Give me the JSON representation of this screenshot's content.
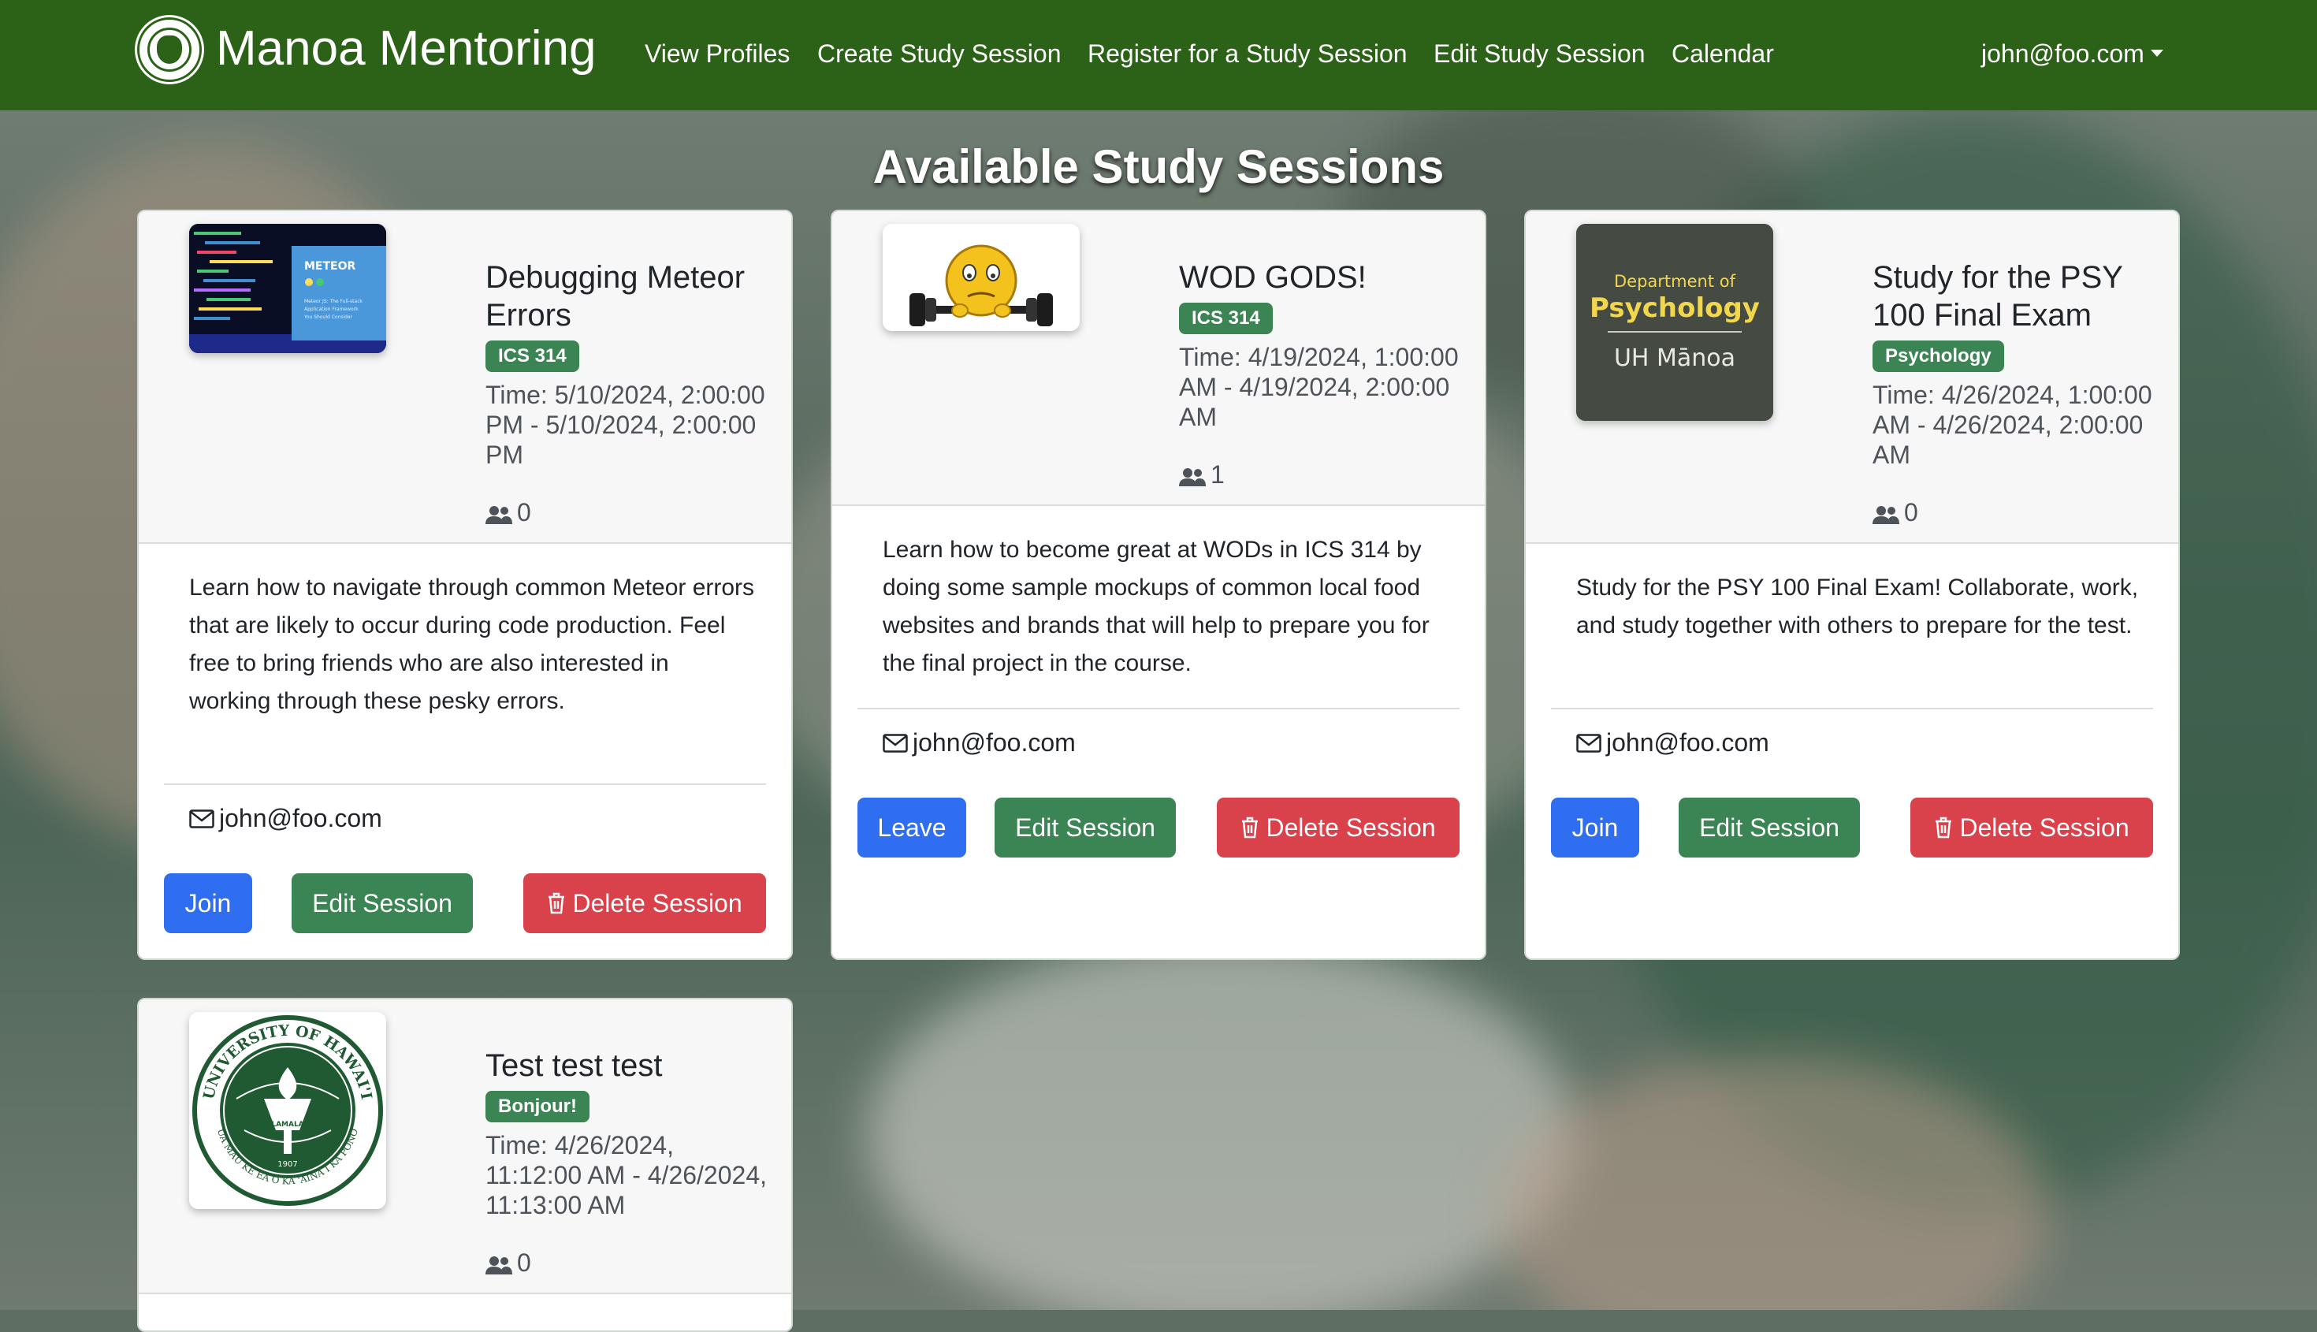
{
  "navbar": {
    "brand": "Manoa Mentoring",
    "links": [
      "View Profiles",
      "Create Study Session",
      "Register for a Study Session",
      "Edit Study Session",
      "Calendar"
    ],
    "user": "john@foo.com"
  },
  "page_title": "Available Study Sessions",
  "sessions": [
    {
      "title": "Debugging Meteor Errors",
      "badge": "ICS 314",
      "time": "Time: 5/10/2024, 2:00:00 PM - 5/10/2024, 2:00:00 PM",
      "count": "0",
      "description": "Learn how to navigate through common Meteor errors that are likely to occur during code production. Feel free to bring friends who are also interested in working through these pesky errors.",
      "email": "john@foo.com",
      "join_label": "Join",
      "edit_label": "Edit Session",
      "delete_label": "Delete Session",
      "thumb": {
        "brand": "METEOR",
        "caption": "Meteor JS: The Full-stack Application Framework You Should Consider"
      }
    },
    {
      "title": "WOD GODS!",
      "badge": "ICS 314",
      "time": "Time: 4/19/2024, 1:00:00 AM - 4/19/2024, 2:00:00 AM",
      "count": "1",
      "description": "Learn how to become great at WODs in ICS 314 by doing some sample mockups of common local food websites and brands that will help to prepare you for the final project in the course.",
      "email": "john@foo.com",
      "join_label": "Leave",
      "edit_label": "Edit Session",
      "delete_label": "Delete Session"
    },
    {
      "title": "Study for the PSY 100 Final Exam",
      "badge": "Psychology",
      "time": "Time: 4/26/2024, 1:00:00 AM - 4/26/2024, 2:00:00 AM",
      "count": "0",
      "description": "Study for the PSY 100 Final Exam! Collaborate, work, and study together with others to prepare for the test.",
      "email": "john@foo.com",
      "join_label": "Join",
      "edit_label": "Edit Session",
      "delete_label": "Delete Session",
      "thumb": {
        "line1": "Department of",
        "line2": "Psychology",
        "line3": "UH Mānoa"
      }
    },
    {
      "title": "Test test test",
      "badge": "Bonjour!",
      "time": "Time: 4/26/2024, 11:12:00 AM - 4/26/2024, 11:13:00 AM",
      "count": "0",
      "thumb": {
        "seal_text": "UNIVERSITY OF HAWAI'I",
        "motto": "UA MAU KE EA O KA 'ĀINA I KA PONO",
        "center": "MĀLAMALAMA",
        "year": "1907"
      }
    }
  ],
  "colors": {
    "navbar": "#2b6218",
    "primary": "#2f6ef1",
    "success": "#3b8453",
    "danger": "#d9414b"
  },
  "icons": {
    "people": "people-icon",
    "envelope": "envelope-icon",
    "trash": "trash-icon"
  }
}
